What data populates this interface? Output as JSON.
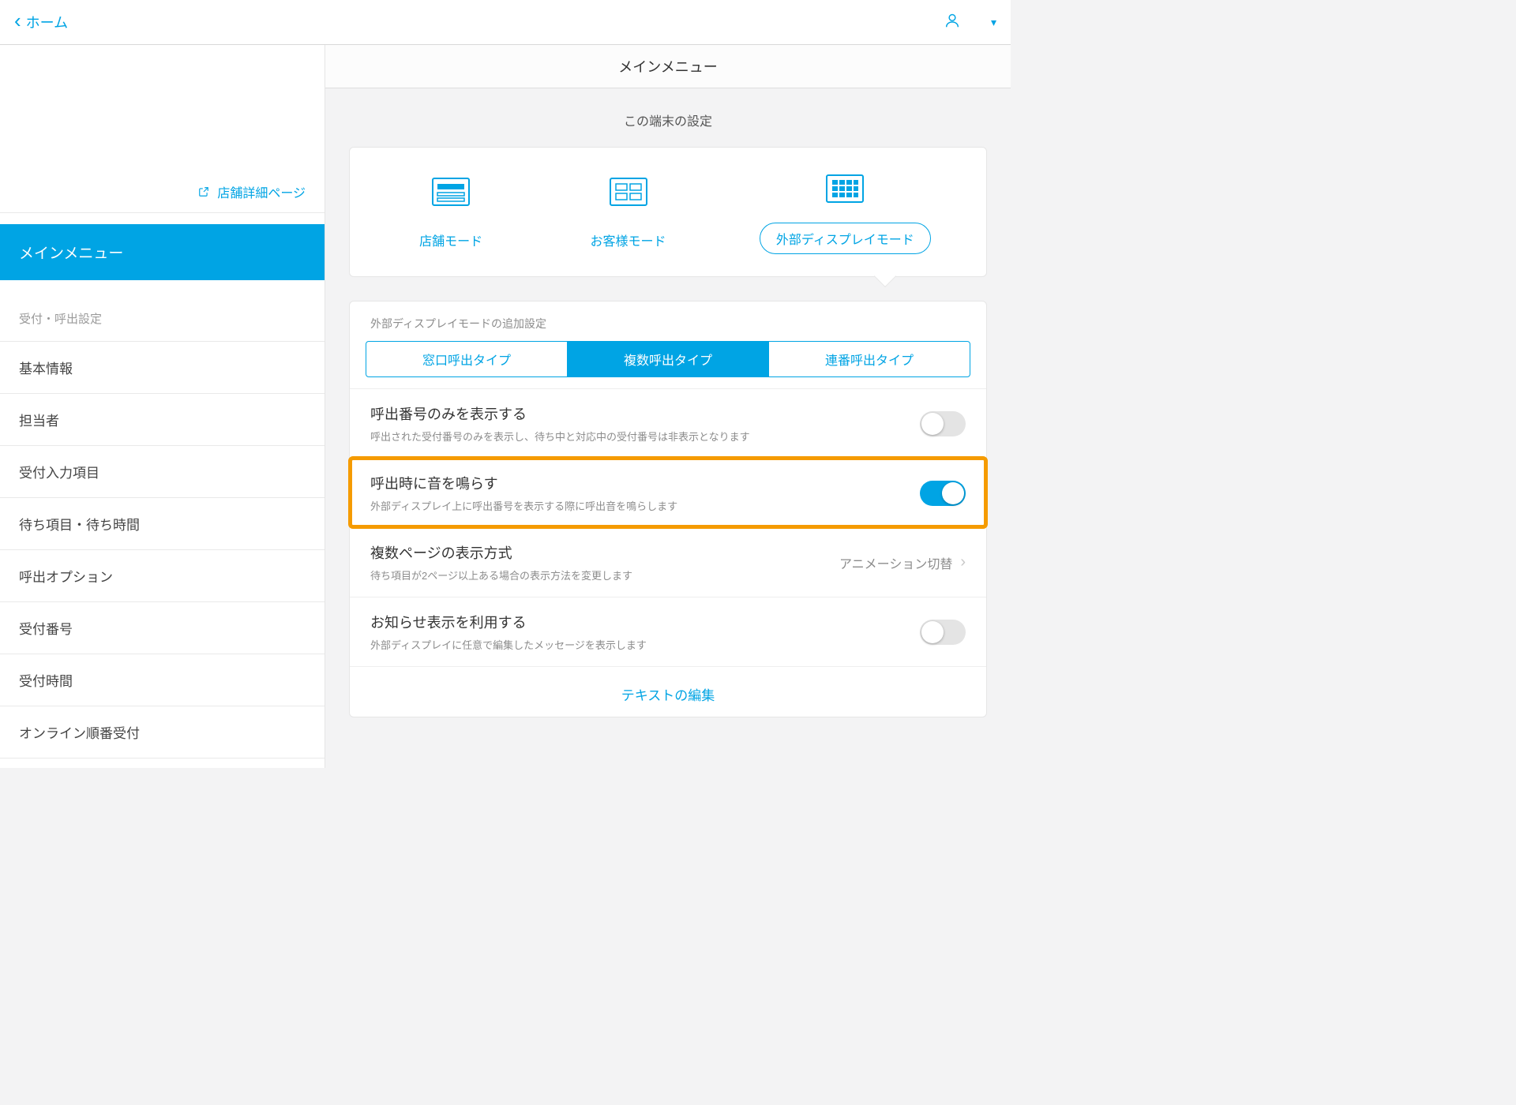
{
  "topbar": {
    "back_label": "ホーム"
  },
  "sidebar": {
    "store_link": "店舗詳細ページ",
    "active_section": "メインメニュー",
    "group_label": "受付・呼出設定",
    "items": [
      "基本情報",
      "担当者",
      "受付入力項目",
      "待ち項目・待ち時間",
      "呼出オプション",
      "受付番号",
      "受付時間",
      "オンライン順番受付"
    ]
  },
  "main": {
    "header": "メインメニュー",
    "device_label": "この端末の設定",
    "modes": [
      {
        "label": "店舗モード"
      },
      {
        "label": "お客様モード"
      },
      {
        "label": "外部ディスプレイモード"
      }
    ],
    "panel_sub": "外部ディスプレイモードの追加設定",
    "seg": [
      "窓口呼出タイプ",
      "複数呼出タイプ",
      "連番呼出タイプ"
    ],
    "settings": {
      "s1": {
        "title": "呼出番号のみを表示する",
        "desc": "呼出された受付番号のみを表示し、待ち中と対応中の受付番号は非表示となります"
      },
      "s2": {
        "title": "呼出時に音を鳴らす",
        "desc": "外部ディスプレイ上に呼出番号を表示する際に呼出音を鳴らします"
      },
      "s3": {
        "title": "複数ページの表示方式",
        "desc": "待ち項目が2ページ以上ある場合の表示方法を変更します",
        "value": "アニメーション切替"
      },
      "s4": {
        "title": "お知らせ表示を利用する",
        "desc": "外部ディスプレイに任意で編集したメッセージを表示します"
      }
    },
    "edit_link": "テキストの編集"
  }
}
